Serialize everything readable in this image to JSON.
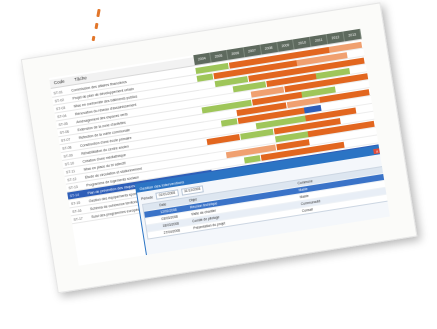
{
  "colors": {
    "accent": "#e2762a",
    "header_bg": "#5e6a5e",
    "orange": "#e2661f",
    "light_orange": "#f0a070",
    "green": "#9fc65a",
    "blue": "#2e5eb8",
    "dialog_blue": "#2b74c4"
  },
  "header": {
    "code_label": "Code",
    "task_label": "Tâche"
  },
  "timeline": [
    "2004",
    "2005",
    "2006",
    "2007",
    "2008",
    "2009",
    "2010",
    "2011",
    "2012",
    "2013"
  ],
  "tasks": [
    {
      "id": "ST-01",
      "name": "Commission des affaires financières"
    },
    {
      "id": "ST-02",
      "name": "Projet de plan de développement urbain"
    },
    {
      "id": "ST-03",
      "name": "Mise en conformité des bâtiments publics"
    },
    {
      "id": "ST-04",
      "name": "Rénovation du réseau d'assainissement"
    },
    {
      "id": "ST-05",
      "name": "Aménagement des espaces verts"
    },
    {
      "id": "ST-06",
      "name": "Extension de la zone d'activités"
    },
    {
      "id": "ST-07",
      "name": "Réfection de la voirie communale"
    },
    {
      "id": "ST-08",
      "name": "Construction d'une école primaire"
    },
    {
      "id": "ST-09",
      "name": "Réhabilitation du centre ancien"
    },
    {
      "id": "ST-10",
      "name": "Création d'une médiathèque"
    },
    {
      "id": "ST-11",
      "name": "Mise en place du tri sélectif"
    },
    {
      "id": "ST-12",
      "name": "Étude de circulation et stationnement"
    },
    {
      "id": "ST-13",
      "name": "Programme de logements sociaux"
    },
    {
      "id": "ST-14",
      "name": "Plan de prévention des risques"
    },
    {
      "id": "ST-15",
      "name": "Gestion des équipements sportifs"
    },
    {
      "id": "ST-16",
      "name": "Schéma de cohérence territoriale"
    },
    {
      "id": "ST-17",
      "name": "Suivi des programmes européens"
    }
  ],
  "dialog": {
    "title": "Gestion des interventions",
    "close_label": "x",
    "filter_label": "Période",
    "from_value": "01/01/2008",
    "to_value": "31/12/2008",
    "columns": [
      "",
      "Date",
      "Objet",
      "Commune",
      ""
    ],
    "rows": [
      {
        "c1": "",
        "c2": "12/02/2008",
        "c3": "Réunion technique",
        "c4": "Mairie",
        "c5": ""
      },
      {
        "c1": "",
        "c2": "03/03/2008",
        "c3": "Visite de chantier",
        "c4": "Mairie",
        "c5": ""
      },
      {
        "c1": "",
        "c2": "18/03/2008",
        "c3": "Comité de pilotage",
        "c4": "Communauté",
        "c5": ""
      },
      {
        "c1": "",
        "c2": "27/04/2008",
        "c3": "Présentation du projet",
        "c4": "Conseil",
        "c5": ""
      }
    ]
  }
}
